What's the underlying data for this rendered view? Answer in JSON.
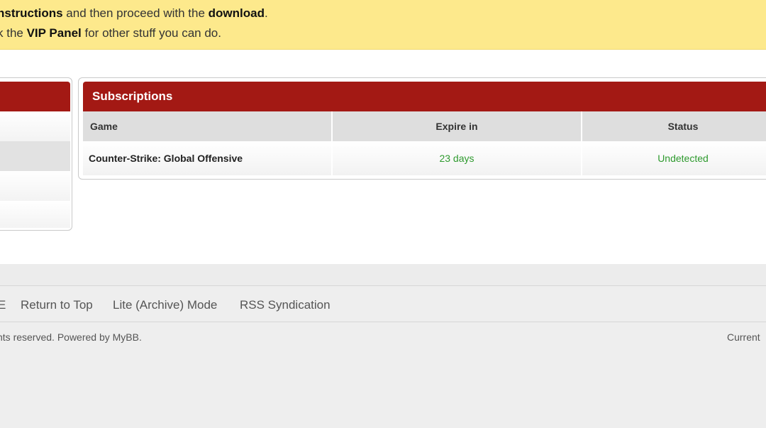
{
  "notice": {
    "line1": {
      "part1": "nstructions",
      "part2": " and then proceed with the ",
      "part3": "download",
      "part4": "."
    },
    "line2": {
      "part1": "k the ",
      "part2": "VIP Panel",
      "part3": " for other stuff you can do."
    }
  },
  "subscriptions": {
    "title": "Subscriptions",
    "columns": {
      "game": "Game",
      "expire": "Expire in",
      "status": "Status"
    },
    "rows": [
      {
        "game": "Counter-Strike: Global Offensive",
        "expire": "23 days",
        "status": "Undetected"
      }
    ]
  },
  "footer": {
    "links": {
      "partial": "E",
      "return_to_top": "Return to Top",
      "lite_mode": "Lite (Archive) Mode",
      "rss": "RSS Syndication"
    },
    "copyright": "nts reserved. Powered by MyBB.",
    "current": "Current"
  },
  "colors": {
    "notice_bg": "#fde98c",
    "header_red": "#a31914",
    "status_green": "#2e9a2e",
    "footer_bg": "#eeeeee"
  }
}
